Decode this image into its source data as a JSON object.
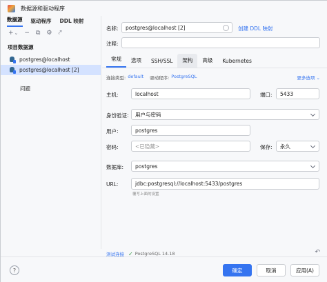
{
  "window": {
    "title": "数据源和驱动程序"
  },
  "left": {
    "tabs": [
      "数据源",
      "驱动程序",
      "DDL 映射"
    ],
    "toolbar": {
      "add": "+",
      "dropdown": "⌄",
      "remove": "−",
      "copy": "⧉",
      "settings": "⚙",
      "export": "⤤",
      "back": "←",
      "forward": "→"
    },
    "section_title": "项目数据源",
    "datasources": [
      "postgres@localhost",
      "postgres@localhost [2]"
    ],
    "problems_label": "问题"
  },
  "form": {
    "name_label": "名称:",
    "name_value": "postgres@localhost [2]",
    "create_ddl_link": "创建 DDL 映射",
    "comment_label": "注释:",
    "tabs": [
      "常规",
      "选项",
      "SSH/SSL",
      "架构",
      "高级",
      "Kubernetes"
    ],
    "conn_type_label": "连接类型:",
    "conn_type_value": "default",
    "driver_label": "驱动程序:",
    "driver_value": "PostgreSQL",
    "more_options": "更多选项 ⌄",
    "host_label": "主机:",
    "host_value": "localhost",
    "port_label": "端口:",
    "port_value": "5433",
    "auth_label": "身份验证:",
    "auth_value": "用户与密码",
    "user_label": "用户:",
    "user_value": "postgres",
    "password_label": "密码:",
    "password_placeholder": "<已隐藏>",
    "save_label": "保存:",
    "save_value": "永久",
    "database_label": "数据库:",
    "database_value": "postgres",
    "url_label": "URL:",
    "url_value": "jdbc:postgresql://localhost:5433/postgres",
    "url_hint": "覆写上面的设置",
    "test_connection": "测试连接",
    "test_check": "✓",
    "test_result": "PostgreSQL 14.18",
    "undo_icon": "↶"
  },
  "buttons": {
    "help": "?",
    "ok": "确定",
    "cancel": "取消",
    "apply": "应用(A)"
  },
  "colors": {
    "accent": "#3574f0",
    "selected_row": "#d4e2ff",
    "success": "#3a9a4a"
  }
}
